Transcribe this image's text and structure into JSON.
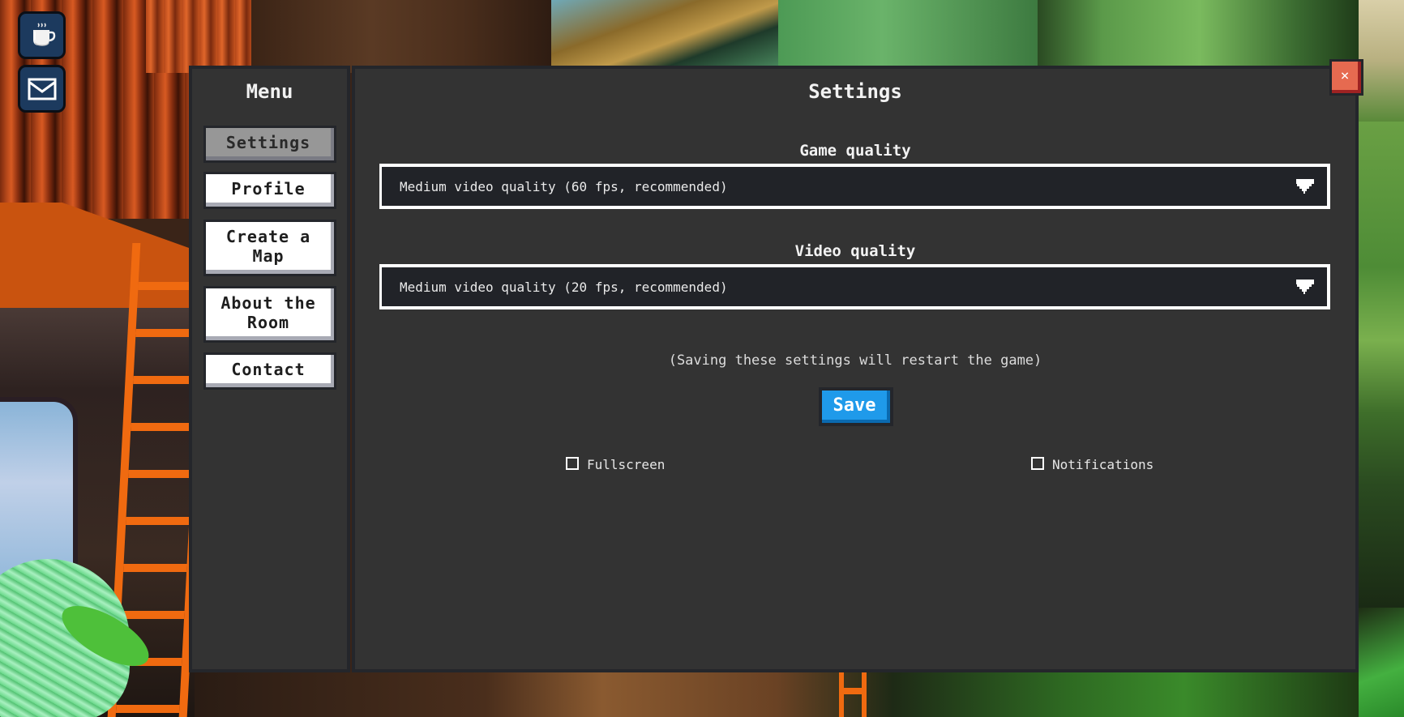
{
  "hud": {
    "buttons": [
      {
        "icon": "coffee-cup-icon"
      },
      {
        "icon": "mail-envelope-icon"
      }
    ]
  },
  "sidebar": {
    "title": "Menu",
    "items": [
      {
        "label": "Settings",
        "active": true
      },
      {
        "label": "Profile",
        "active": false
      },
      {
        "label": "Create a Map",
        "active": false
      },
      {
        "label": "About the Room",
        "active": false
      },
      {
        "label": "Contact",
        "active": false
      }
    ]
  },
  "main": {
    "title": "Settings",
    "game_quality": {
      "label": "Game quality",
      "selected": "Medium video quality (60 fps, recommended)"
    },
    "video_quality": {
      "label": "Video quality",
      "selected": "Medium video quality (20 fps, recommended)"
    },
    "note": "(Saving these settings will restart the game)",
    "save_label": "Save",
    "checkboxes": [
      {
        "label": "Fullscreen",
        "checked": false
      },
      {
        "label": "Notifications",
        "checked": false
      }
    ]
  },
  "close": {
    "icon": "close-icon",
    "glyph": "×"
  },
  "colors": {
    "panel": "#333333",
    "panel_border": "#24262b",
    "select_bg": "#212328",
    "save_blue": "#1f9aea",
    "close_red": "#e66a50",
    "hud_navy": "#1c3a5e"
  }
}
